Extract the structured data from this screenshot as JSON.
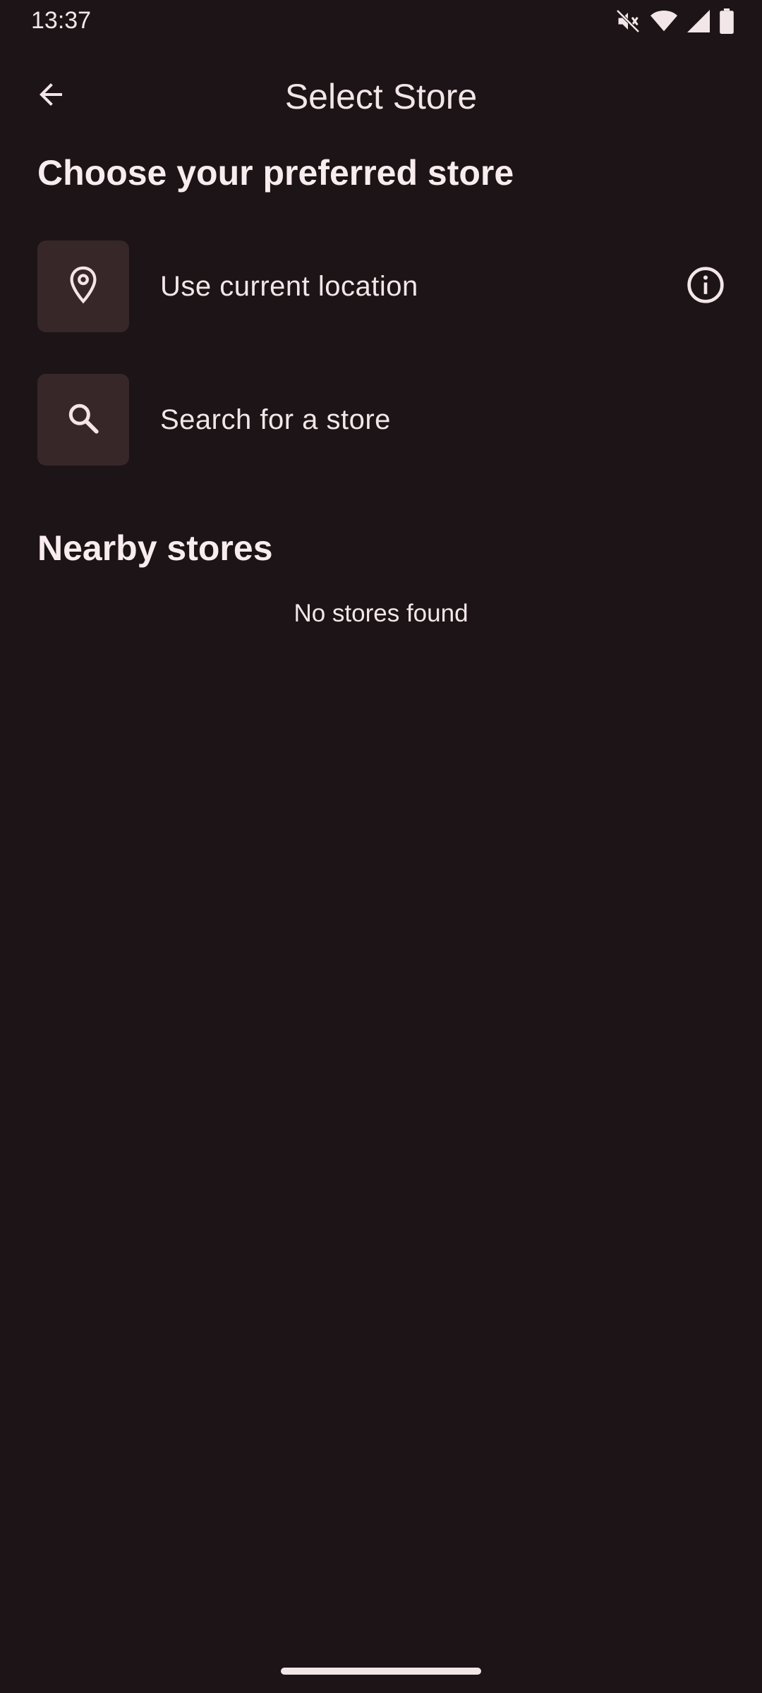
{
  "status_bar": {
    "time": "13:37",
    "icons": [
      "mute-icon",
      "wifi-icon",
      "signal-icon",
      "battery-icon"
    ]
  },
  "app_bar": {
    "title": "Select Store",
    "back_icon": "arrow-back-icon"
  },
  "choose_section": {
    "heading": "Choose your preferred store",
    "options": [
      {
        "label": "Use current location",
        "icon": "location-pin-icon",
        "trailing_icon": "info-icon"
      },
      {
        "label": "Search for a store",
        "icon": "search-icon"
      }
    ]
  },
  "nearby_section": {
    "heading": "Nearby stores",
    "empty_message": "No stores found"
  },
  "colors": {
    "background": "#1c1416",
    "tile": "#382729",
    "text": "#f3e6e8"
  }
}
